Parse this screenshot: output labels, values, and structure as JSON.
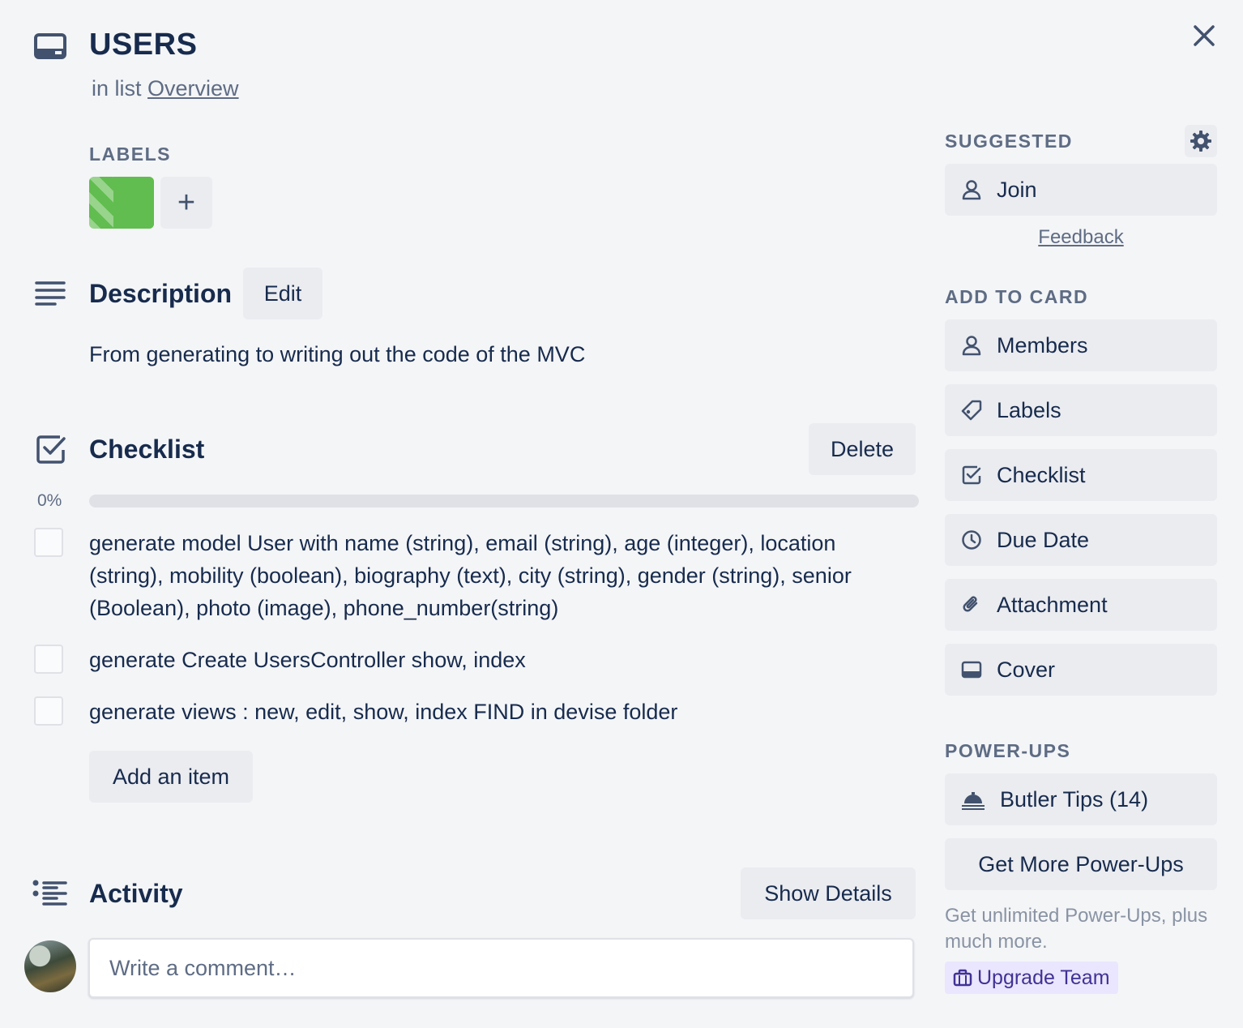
{
  "card": {
    "title": "USERS",
    "in_list_prefix": "in list",
    "list_name": "Overview"
  },
  "labels": {
    "heading": "LABELS",
    "add_symbol": "+",
    "chip_color": "#61bd4f"
  },
  "description": {
    "title": "Description",
    "edit_label": "Edit",
    "text": "From generating to writing out the code of the MVC"
  },
  "checklist": {
    "title": "Checklist",
    "delete_label": "Delete",
    "progress_text": "0%",
    "progress_fraction": 0,
    "items": [
      {
        "text": "generate model User with name (string), email (string), age (integer), location (string), mobility (boolean), biography (text), city (string), gender (string), senior (Boolean), photo (image), phone_number(string)",
        "checked": false
      },
      {
        "text": "generate Create UsersController show, index",
        "checked": false
      },
      {
        "text": "generate views : new, edit, show, index FIND in devise folder",
        "checked": false
      }
    ],
    "add_item_label": "Add an item"
  },
  "activity": {
    "title": "Activity",
    "show_details_label": "Show Details",
    "comment_placeholder": "Write a comment…"
  },
  "sidebar": {
    "suggested_heading": "SUGGESTED",
    "join_label": "Join",
    "feedback_label": "Feedback",
    "add_to_card_heading": "ADD TO CARD",
    "members_label": "Members",
    "labels_label": "Labels",
    "checklist_label": "Checklist",
    "due_date_label": "Due Date",
    "attachment_label": "Attachment",
    "cover_label": "Cover",
    "powerups_heading": "POWER-UPS",
    "butler_label": "Butler Tips (14)",
    "get_more_label": "Get More Power-Ups",
    "promo_text": "Get unlimited Power-Ups, plus much more.",
    "upgrade_label": "Upgrade Team"
  },
  "icons": {
    "card": "card-icon",
    "close": "close-icon",
    "description": "description-icon",
    "checklist": "checklist-icon",
    "activity": "activity-icon",
    "gear": "gear-icon",
    "person": "person-icon",
    "tag": "tag-icon",
    "clock": "clock-icon",
    "paperclip": "paperclip-icon",
    "cover": "cover-icon",
    "bell": "butler-bell-icon",
    "briefcase": "briefcase-icon"
  },
  "colors": {
    "background": "#f4f5f7",
    "button": "#ebecf0",
    "text": "#172b4d",
    "muted": "#5e6c84",
    "upgrade_bg": "#eae6ff",
    "upgrade_text": "#403294"
  }
}
